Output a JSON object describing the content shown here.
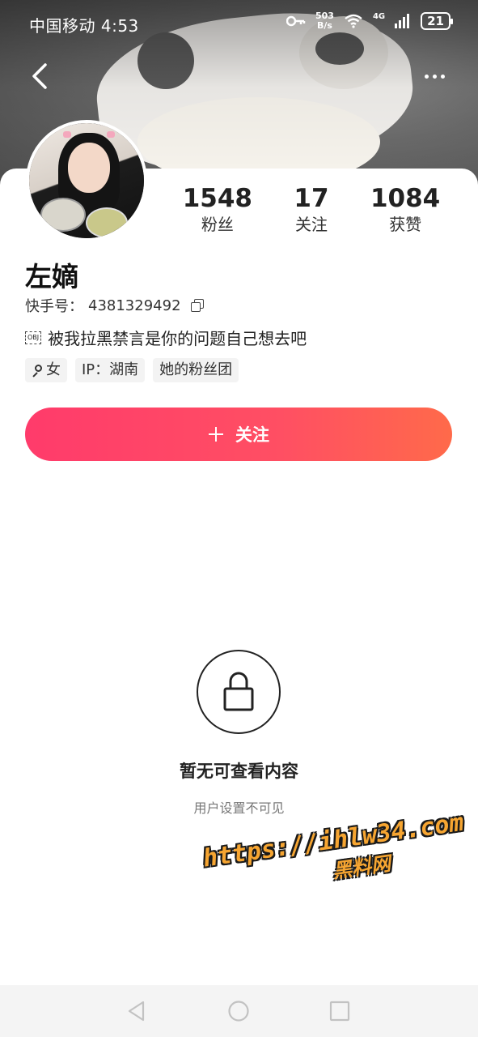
{
  "status_bar": {
    "carrier_time": "中国移动 4:53",
    "net_speed_value": "503",
    "net_speed_unit": "B/s",
    "network": "4G",
    "battery": "21",
    "icons": [
      "key-icon",
      "wifi-icon",
      "signal-icon",
      "battery-icon"
    ]
  },
  "header": {
    "back_icon": "chevron-left-icon",
    "more_icon": "more-horizontal-icon"
  },
  "profile": {
    "stats": [
      {
        "value": "1548",
        "label": "粉丝"
      },
      {
        "value": "17",
        "label": "关注"
      },
      {
        "value": "1084",
        "label": "获赞"
      }
    ],
    "name": "左嫡",
    "id_label": "快手号：",
    "id_value": "4381329492",
    "bio_icon": "OBJ",
    "bio": "被我拉黑禁言是你的问题自己想去吧",
    "tags": {
      "gender": "女",
      "ip": "IP：湖南",
      "fan_club": "她的粉丝团"
    }
  },
  "follow_button": {
    "label": "关注"
  },
  "empty_state": {
    "title": "暂无可查看内容",
    "subtitle": "用户设置不可见"
  },
  "watermark": {
    "url": "https://ihlw34.com",
    "name": "黑料网"
  },
  "colors": {
    "follow_start": "#ff3b6b",
    "follow_end": "#ff6a4a",
    "watermark": "#f6a531"
  }
}
